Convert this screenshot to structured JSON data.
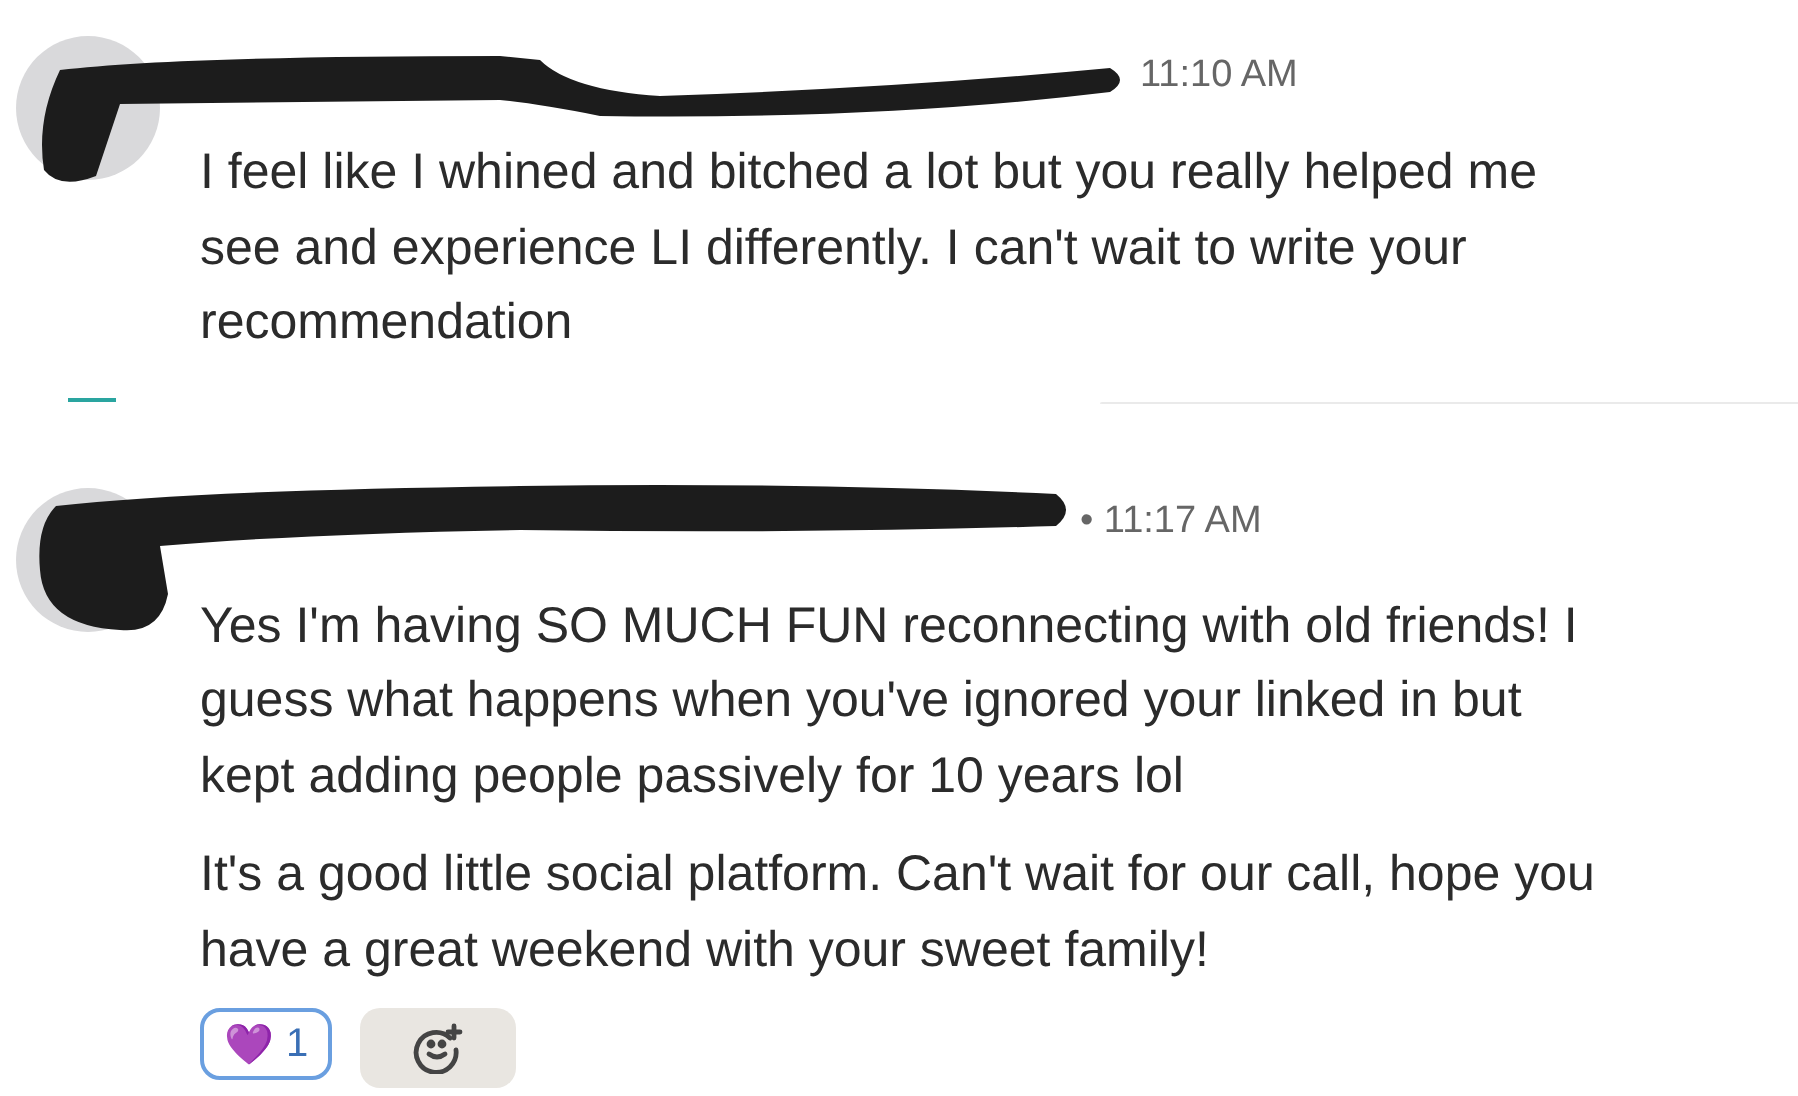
{
  "messages": [
    {
      "time": "11:10 AM",
      "paragraphs": [
        "I feel like I whined and bitched a lot but you really helped me see and experience LI differently. I can't wait to write your recommendation"
      ]
    },
    {
      "time": "• 11:17 AM",
      "paragraphs": [
        "Yes I'm having SO MUCH FUN reconnecting with old friends! I guess what happens when you've ignored your linked in but kept adding people passively for 10 years lol",
        "It's a good little social platform. Can't wait for our call, hope you have a great weekend with your sweet family!"
      ],
      "reactions": [
        {
          "emoji": "💜",
          "count": "1",
          "selected": true
        }
      ]
    }
  ]
}
